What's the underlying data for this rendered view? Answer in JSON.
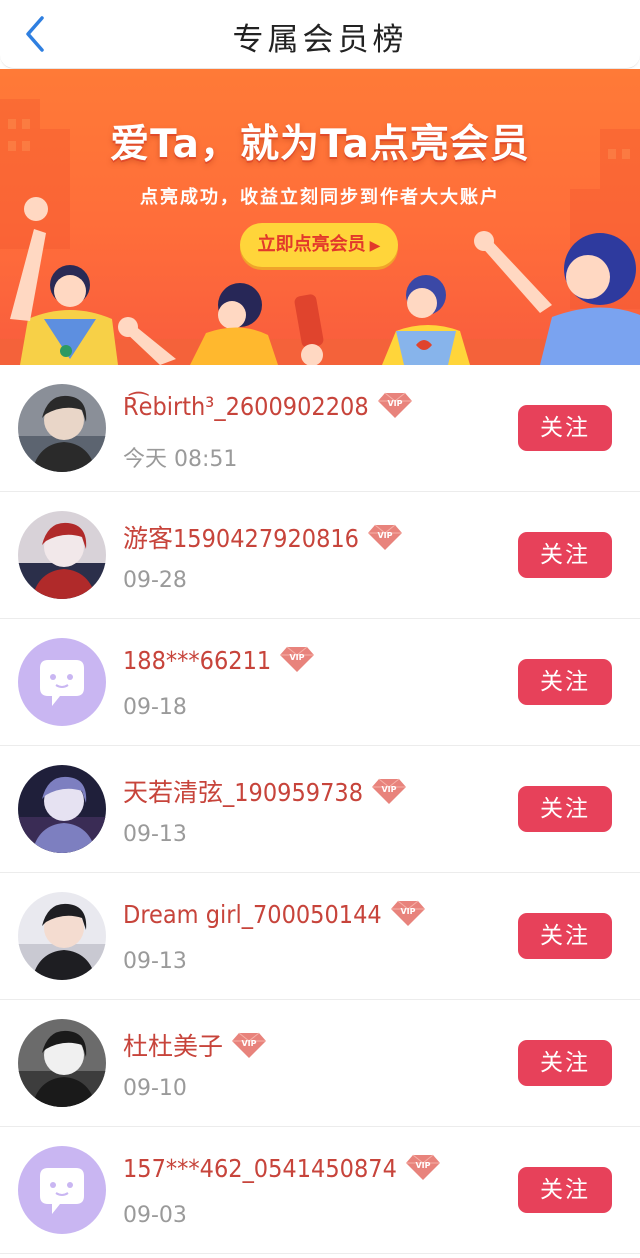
{
  "header": {
    "title": "专属会员榜",
    "back_icon": "chevron-left-icon"
  },
  "banner": {
    "headline": "爱Ta，就为Ta点亮会员",
    "subtitle": "点亮成功，收益立刻同步到作者大大账户",
    "cta_label": "立即点亮会员",
    "cta_arrow": "▶"
  },
  "follow_label": "关注",
  "members": [
    {
      "name": "R͡ebirth³_2600902208",
      "date": "今天  08:51",
      "avatar": "photo"
    },
    {
      "name": "游客1590427920816",
      "date": "09-28",
      "avatar": "photo"
    },
    {
      "name": "188***66211",
      "date": "09-18",
      "avatar": "default"
    },
    {
      "name": "天若清弦_190959738",
      "date": "09-13",
      "avatar": "photo"
    },
    {
      "name": "Dream girl_700050144",
      "date": "09-13",
      "avatar": "photo"
    },
    {
      "name": "杜杜美子",
      "date": "09-10",
      "avatar": "photo"
    },
    {
      "name": "157***462_0541450874",
      "date": "09-03",
      "avatar": "default"
    }
  ],
  "colors": {
    "accent": "#e7415a",
    "name": "#c7443b",
    "banner": "#ff7a37",
    "vip_badge": "#e8837c"
  }
}
